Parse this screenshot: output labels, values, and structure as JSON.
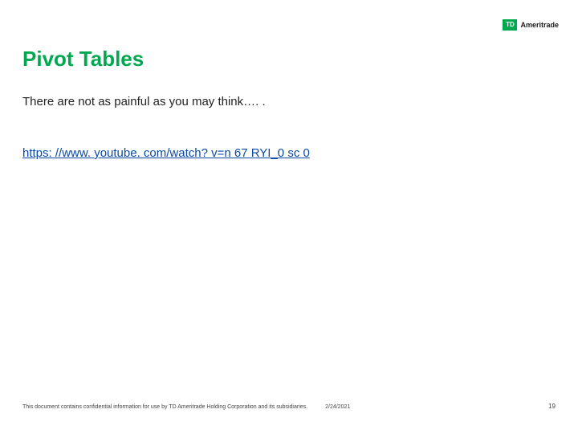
{
  "logo": {
    "mark_text": "TD",
    "brand_name": "Ameritrade"
  },
  "title": "Pivot Tables",
  "body": "There are not as painful as you may think…. .",
  "link_text": "https: //www. youtube. com/watch? v=n 67 RYI_0 sc 0",
  "footer": {
    "confidentiality": "This document contains confidential information for use by TD Ameritrade Holding Corporation and its subsidiaries.",
    "date": "2/24/2021",
    "page": "19"
  }
}
